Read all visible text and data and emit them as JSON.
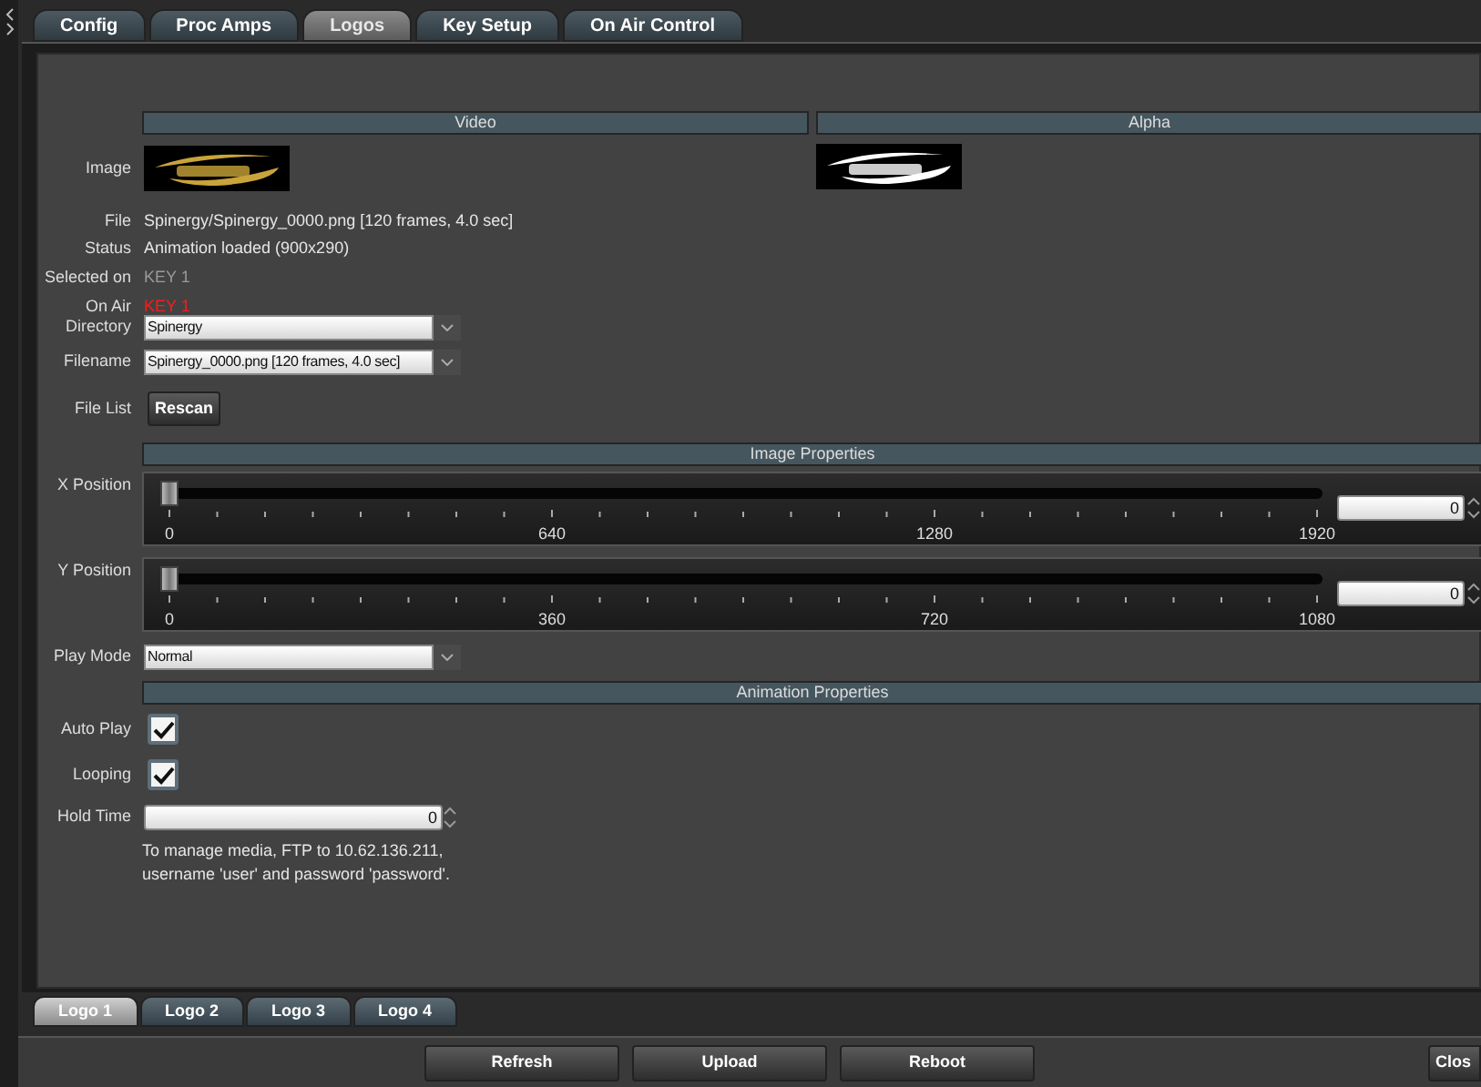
{
  "tabs": [
    {
      "label": "Config",
      "selected": false
    },
    {
      "label": "Proc Amps",
      "selected": false
    },
    {
      "label": "Logos",
      "selected": true
    },
    {
      "label": "Key Setup",
      "selected": false
    },
    {
      "label": "On Air Control",
      "selected": false
    }
  ],
  "logo": {
    "headers": [
      "Video",
      "Alpha"
    ],
    "image": {
      "label": "Image"
    },
    "info": [
      {
        "label": "File",
        "value": "Spinergy/Spinergy_0000.png [120 frames, 4.0 sec]",
        "kind": "normal"
      },
      {
        "label": "Status",
        "value": "Animation loaded (900x290)",
        "kind": "normal"
      },
      {
        "label": "Selected on",
        "value": "KEY 1",
        "kind": "dim"
      },
      {
        "label": "On Air",
        "value": "KEY 1",
        "kind": "alert"
      }
    ],
    "directory": {
      "label": "Directory",
      "value": "Spinergy"
    },
    "filename": {
      "label": "Filename",
      "value": "Spinergy_0000.png [120 frames, 4.0 sec]"
    },
    "file_list": {
      "label": "File List",
      "button": "Rescan"
    }
  },
  "image_properties": {
    "title": "Image Properties",
    "sliders": [
      {
        "label": "X Position",
        "level": 0,
        "value": "0",
        "ticks": [
          "0",
          "640",
          "1280",
          "1920"
        ]
      },
      {
        "label": "Y Position",
        "level": 0,
        "value": "0",
        "ticks": [
          "0",
          "360",
          "720",
          "1080"
        ]
      }
    ],
    "play_mode": {
      "label": "Play Mode",
      "value": "Normal"
    }
  },
  "animation_properties": {
    "title": "Animation Properties",
    "checkboxes": [
      {
        "label": "Auto Play",
        "checked": true
      },
      {
        "label": "Looping",
        "checked": true
      }
    ],
    "hold_time": {
      "label": "Hold Time",
      "value": "0"
    },
    "note": [
      "To manage media, FTP to 10.62.136.211,",
      "username 'user' and password 'password'."
    ]
  },
  "logo_tabs": [
    {
      "label": "Logo 1",
      "selected": true
    },
    {
      "label": "Logo 2",
      "selected": false
    },
    {
      "label": "Logo 3",
      "selected": false
    },
    {
      "label": "Logo 4",
      "selected": false
    }
  ],
  "buttons": [
    "Refresh",
    "Upload",
    "Reboot"
  ],
  "close_button": "Clos"
}
